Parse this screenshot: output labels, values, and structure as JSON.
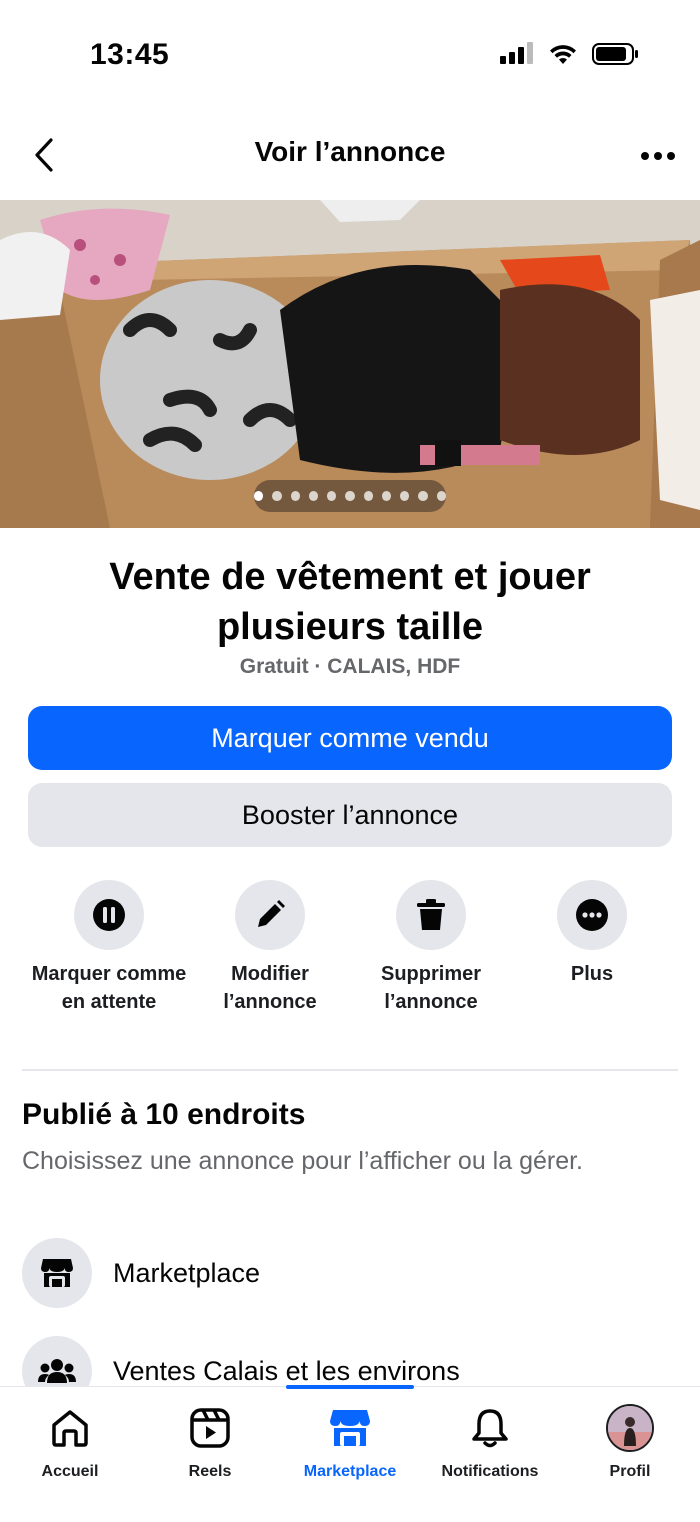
{
  "status_bar": {
    "time": "13:45"
  },
  "header": {
    "title": "Voir l’annonce",
    "back_icon": "chevron-left-icon",
    "more_icon": "ellipsis-horizontal-icon"
  },
  "photo": {
    "page_count": 11,
    "current_page": 1
  },
  "listing": {
    "title": "Vente de vêtement et jouer plusieurs taille",
    "meta": "Gratuit · CALAIS, HDF"
  },
  "buttons": {
    "mark_sold": "Marquer comme vendu",
    "boost": "Booster l’annonce"
  },
  "actions": [
    {
      "label": "Marquer comme en attente",
      "icon": "pause-icon"
    },
    {
      "label": "Modifier l’annonce",
      "icon": "pencil-icon"
    },
    {
      "label": "Supprimer l’annonce",
      "icon": "trash-icon"
    },
    {
      "label": "Plus",
      "icon": "more-circle-icon"
    }
  ],
  "published": {
    "title": "Publié à 10 endroits",
    "subtitle": "Choisissez une annonce pour l’afficher ou la gérer.",
    "places": [
      {
        "name": "Marketplace",
        "icon": "store-icon"
      },
      {
        "name": "Ventes Calais et les environs",
        "icon": "group-icon"
      }
    ]
  },
  "bottom_nav": {
    "items": [
      {
        "label": "Accueil",
        "icon": "home-icon"
      },
      {
        "label": "Reels",
        "icon": "reels-icon"
      },
      {
        "label": "Marketplace",
        "icon": "marketplace-icon",
        "active": true
      },
      {
        "label": "Notifications",
        "icon": "bell-icon"
      },
      {
        "label": "Profil",
        "icon": "avatar"
      }
    ]
  },
  "colors": {
    "primary": "#0866ff",
    "secondary_bg": "#e4e6eb",
    "muted_text": "#65676b"
  }
}
